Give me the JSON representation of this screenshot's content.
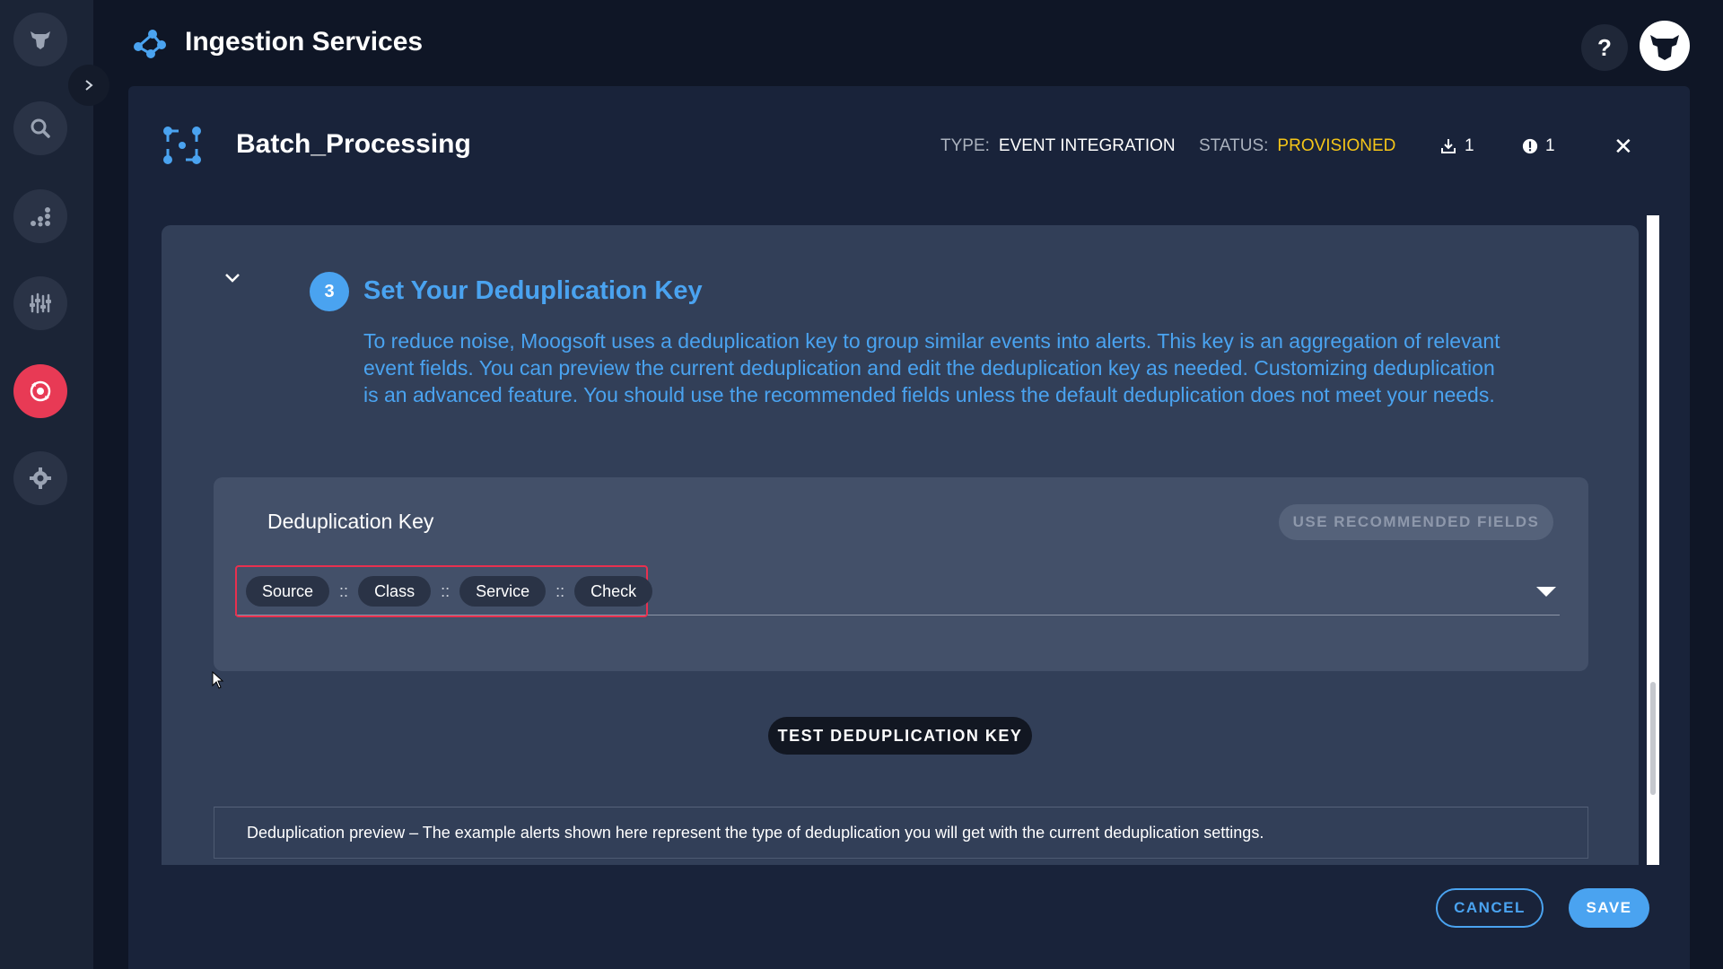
{
  "app": {
    "title": "Ingestion Services"
  },
  "topbar": {
    "help_label": "?"
  },
  "sidebar": {
    "items": [
      {
        "name": "moogsoft-logo-icon"
      },
      {
        "name": "search-icon"
      },
      {
        "name": "analytics-icon"
      },
      {
        "name": "tuning-icon"
      },
      {
        "name": "integrations-icon",
        "active": true
      },
      {
        "name": "settings-icon"
      }
    ]
  },
  "entity": {
    "title": "Batch_Processing",
    "type_label": "TYPE:",
    "type_value": "EVENT INTEGRATION",
    "status_label": "STATUS:",
    "status_value": "PROVISIONED",
    "downloads_count": "1",
    "alerts_count": "1"
  },
  "step": {
    "number": "3",
    "title": "Set Your Deduplication Key",
    "description": "To reduce noise, Moogsoft uses a deduplication key to group similar events into alerts. This key is an aggregation of relevant event fields. You can preview the current deduplication and edit the deduplication key as needed. Customizing deduplication is an advanced feature. You should use the recommended fields unless the default deduplication does not meet your needs."
  },
  "dedup": {
    "label": "Deduplication Key",
    "recommend_label": "USE RECOMMENDED FIELDS",
    "separator": "::",
    "fields": [
      "Source",
      "Class",
      "Service",
      "Check"
    ]
  },
  "test_button": "TEST DEDUPLICATION KEY",
  "preview_text": "Deduplication preview – The example alerts shown here represent the type of deduplication you will get with the current deduplication settings.",
  "footer": {
    "cancel_label": "CANCEL",
    "save_label": "SAVE"
  },
  "colors": {
    "accent": "#4aa3f0",
    "status": "#f5c518",
    "highlight": "#e8304f",
    "active_nav": "#e83a55"
  }
}
